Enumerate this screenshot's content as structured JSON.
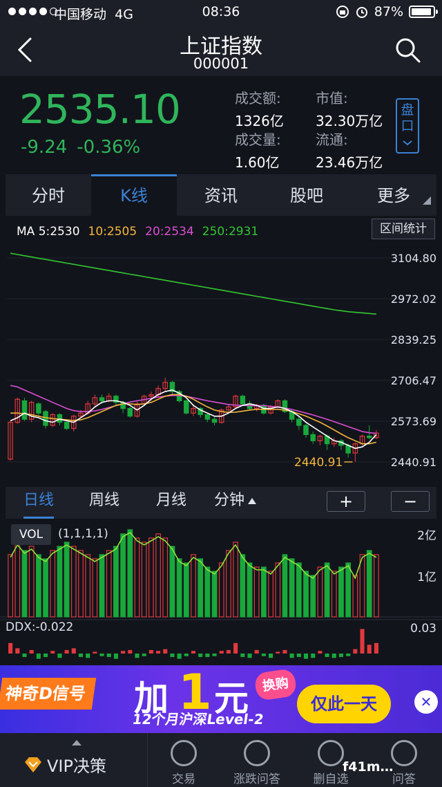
{
  "status": {
    "carrier": "中国移动",
    "network": "4G",
    "time": "08:36",
    "battery": "87%",
    "battery_level": 0.87
  },
  "nav": {
    "title": "上证指数",
    "code": "000001"
  },
  "quote": {
    "price": "2535.10",
    "change": "-9.24",
    "change_pct": "-0.36%",
    "turnover_label": "成交额:",
    "turnover": "1326亿",
    "mktcap_label": "市值:",
    "mktcap": "32.30万亿",
    "volume_label": "成交量:",
    "volume": "1.60亿",
    "float_label": "流通:",
    "float": "23.46万亿",
    "pan_label": "盘口"
  },
  "tabs": [
    "分时",
    "K线",
    "资讯",
    "股吧",
    "更多"
  ],
  "ma": {
    "ma5": "MA 5:2530",
    "ma10": "10:2505",
    "ma20": "20:2534",
    "ma250": "250:2931"
  },
  "range_button": "区间统计",
  "yaxis": [
    "3104.80",
    "2972.02",
    "2839.25",
    "2706.47",
    "2573.69",
    "2440.91"
  ],
  "low_marker": "2440.91",
  "periods": [
    "日线",
    "周线",
    "月线",
    "分钟"
  ],
  "zoom": {
    "plus": "+",
    "minus": "−"
  },
  "vol": {
    "tag": "VOL",
    "params": "(1,1,1,1)",
    "y_top": "2亿",
    "y_mid": "1亿"
  },
  "ddx": {
    "label": "DDX:-0.022",
    "y_top": "0.03"
  },
  "banner": {
    "tag": "神奇D信号",
    "jia": "加",
    "one": "1",
    "yuan": "元",
    "swap": "换购",
    "sub": "12个月沪深Level-2",
    "only": "仅此一天",
    "close": "✕"
  },
  "bottom": {
    "vip": "VIP决策",
    "items": [
      "交易",
      "涨跌问答",
      "删自选",
      "问答"
    ]
  },
  "watermark": "f41m…",
  "colors": {
    "up": "#e0393e",
    "down": "#18a83c",
    "accent": "#3b82d6",
    "ma5": "#ffffff",
    "ma10": "#f5b73b",
    "ma20": "#d94fd4",
    "ma250": "#32c832"
  },
  "chart_data": {
    "type": "candlestick",
    "ylim": [
      2440.91,
      3104.8
    ],
    "candles": [
      {
        "o": 2450,
        "c": 2570,
        "h": 2575,
        "l": 2445
      },
      {
        "o": 2570,
        "c": 2645,
        "h": 2650,
        "l": 2565
      },
      {
        "o": 2640,
        "c": 2580,
        "h": 2650,
        "l": 2575
      },
      {
        "o": 2580,
        "c": 2635,
        "h": 2640,
        "l": 2570
      },
      {
        "o": 2630,
        "c": 2600,
        "h": 2635,
        "l": 2590
      },
      {
        "o": 2605,
        "c": 2560,
        "h": 2610,
        "l": 2550
      },
      {
        "o": 2560,
        "c": 2595,
        "h": 2600,
        "l": 2555
      },
      {
        "o": 2595,
        "c": 2570,
        "h": 2600,
        "l": 2560
      },
      {
        "o": 2570,
        "c": 2550,
        "h": 2575,
        "l": 2545
      },
      {
        "o": 2550,
        "c": 2590,
        "h": 2595,
        "l": 2540
      },
      {
        "o": 2590,
        "c": 2600,
        "h": 2610,
        "l": 2585
      },
      {
        "o": 2600,
        "c": 2630,
        "h": 2640,
        "l": 2595
      },
      {
        "o": 2630,
        "c": 2650,
        "h": 2660,
        "l": 2620
      },
      {
        "o": 2650,
        "c": 2640,
        "h": 2660,
        "l": 2630
      },
      {
        "o": 2640,
        "c": 2655,
        "h": 2665,
        "l": 2635
      },
      {
        "o": 2655,
        "c": 2635,
        "h": 2660,
        "l": 2625
      },
      {
        "o": 2635,
        "c": 2615,
        "h": 2640,
        "l": 2600
      },
      {
        "o": 2615,
        "c": 2590,
        "h": 2620,
        "l": 2585
      },
      {
        "o": 2590,
        "c": 2630,
        "h": 2640,
        "l": 2585
      },
      {
        "o": 2630,
        "c": 2655,
        "h": 2660,
        "l": 2625
      },
      {
        "o": 2655,
        "c": 2660,
        "h": 2670,
        "l": 2640
      },
      {
        "o": 2660,
        "c": 2680,
        "h": 2690,
        "l": 2650
      },
      {
        "o": 2680,
        "c": 2700,
        "h": 2715,
        "l": 2670
      },
      {
        "o": 2700,
        "c": 2670,
        "h": 2705,
        "l": 2660
      },
      {
        "o": 2670,
        "c": 2640,
        "h": 2675,
        "l": 2635
      },
      {
        "o": 2640,
        "c": 2600,
        "h": 2645,
        "l": 2595
      },
      {
        "o": 2600,
        "c": 2615,
        "h": 2625,
        "l": 2590
      },
      {
        "o": 2615,
        "c": 2595,
        "h": 2620,
        "l": 2585
      },
      {
        "o": 2595,
        "c": 2580,
        "h": 2600,
        "l": 2570
      },
      {
        "o": 2580,
        "c": 2570,
        "h": 2590,
        "l": 2560
      },
      {
        "o": 2570,
        "c": 2610,
        "h": 2615,
        "l": 2565
      },
      {
        "o": 2610,
        "c": 2620,
        "h": 2630,
        "l": 2600
      },
      {
        "o": 2620,
        "c": 2655,
        "h": 2660,
        "l": 2615
      },
      {
        "o": 2655,
        "c": 2630,
        "h": 2660,
        "l": 2625
      },
      {
        "o": 2630,
        "c": 2615,
        "h": 2640,
        "l": 2610
      },
      {
        "o": 2615,
        "c": 2625,
        "h": 2630,
        "l": 2605
      },
      {
        "o": 2625,
        "c": 2600,
        "h": 2630,
        "l": 2595
      },
      {
        "o": 2600,
        "c": 2620,
        "h": 2625,
        "l": 2595
      },
      {
        "o": 2620,
        "c": 2640,
        "h": 2645,
        "l": 2615
      },
      {
        "o": 2640,
        "c": 2605,
        "h": 2645,
        "l": 2600
      },
      {
        "o": 2605,
        "c": 2580,
        "h": 2610,
        "l": 2570
      },
      {
        "o": 2580,
        "c": 2560,
        "h": 2590,
        "l": 2545
      },
      {
        "o": 2560,
        "c": 2530,
        "h": 2565,
        "l": 2520
      },
      {
        "o": 2530,
        "c": 2510,
        "h": 2540,
        "l": 2500
      },
      {
        "o": 2510,
        "c": 2525,
        "h": 2530,
        "l": 2495
      },
      {
        "o": 2525,
        "c": 2500,
        "h": 2530,
        "l": 2480
      },
      {
        "o": 2500,
        "c": 2510,
        "h": 2520,
        "l": 2490
      },
      {
        "o": 2510,
        "c": 2495,
        "h": 2515,
        "l": 2480
      },
      {
        "o": 2495,
        "c": 2470,
        "h": 2500,
        "l": 2455
      },
      {
        "o": 2470,
        "c": 2500,
        "h": 2505,
        "l": 2441
      },
      {
        "o": 2500,
        "c": 2525,
        "h": 2530,
        "l": 2495
      },
      {
        "o": 2525,
        "c": 2520,
        "h": 2560,
        "l": 2515
      },
      {
        "o": 2520,
        "c": 2535,
        "h": 2545,
        "l": 2515
      }
    ],
    "ma5": [
      2575,
      2585,
      2600,
      2590,
      2585,
      2575,
      2570,
      2580,
      2575,
      2570,
      2585,
      2600,
      2620,
      2635,
      2640,
      2640,
      2635,
      2625,
      2610,
      2625,
      2645,
      2660,
      2670,
      2675,
      2665,
      2650,
      2625,
      2610,
      2600,
      2590,
      2590,
      2600,
      2615,
      2625,
      2630,
      2625,
      2615,
      2615,
      2620,
      2615,
      2605,
      2590,
      2570,
      2555,
      2540,
      2525,
      2510,
      2505,
      2495,
      2485,
      2490,
      2505,
      2530
    ],
    "ma10": [
      2600,
      2600,
      2598,
      2595,
      2590,
      2585,
      2582,
      2580,
      2578,
      2576,
      2578,
      2585,
      2595,
      2605,
      2615,
      2625,
      2630,
      2630,
      2628,
      2630,
      2635,
      2645,
      2655,
      2660,
      2660,
      2655,
      2645,
      2632,
      2620,
      2610,
      2605,
      2602,
      2603,
      2606,
      2610,
      2612,
      2612,
      2612,
      2612,
      2610,
      2605,
      2598,
      2590,
      2580,
      2570,
      2558,
      2545,
      2532,
      2520,
      2510,
      2500,
      2500,
      2505
    ],
    "ma20": [
      2690,
      2685,
      2675,
      2665,
      2655,
      2645,
      2635,
      2625,
      2615,
      2608,
      2605,
      2605,
      2607,
      2612,
      2618,
      2624,
      2630,
      2636,
      2640,
      2644,
      2648,
      2652,
      2655,
      2657,
      2657,
      2655,
      2650,
      2645,
      2640,
      2636,
      2632,
      2628,
      2626,
      2625,
      2624,
      2624,
      2624,
      2622,
      2620,
      2616,
      2612,
      2606,
      2600,
      2594,
      2587,
      2580,
      2572,
      2564,
      2556,
      2548,
      2540,
      2536,
      2534
    ],
    "ma250": [
      3120,
      3116,
      3112,
      3108,
      3104,
      3100,
      3096,
      3092,
      3088,
      3084,
      3080,
      3076,
      3072,
      3068,
      3064,
      3060,
      3056,
      3052,
      3048,
      3044,
      3040,
      3036,
      3032,
      3028,
      3024,
      3020,
      3016,
      3012,
      3008,
      3004,
      3000,
      2996,
      2992,
      2988,
      2984,
      2980,
      2976,
      2972,
      2968,
      2964,
      2960,
      2956,
      2952,
      2948,
      2944,
      2940,
      2936,
      2933,
      2930,
      2928,
      2926,
      2924,
      2922
    ],
    "volume_ylim": [
      0,
      2.2
    ],
    "volume": [
      1.5,
      1.8,
      1.6,
      1.7,
      1.5,
      1.4,
      1.6,
      1.7,
      1.8,
      1.7,
      1.6,
      1.5,
      1.4,
      1.5,
      1.6,
      1.7,
      2.0,
      2.1,
      1.9,
      1.8,
      1.9,
      2.0,
      1.9,
      1.7,
      1.4,
      1.3,
      1.5,
      1.4,
      1.2,
      1.1,
      1.3,
      1.6,
      1.8,
      1.5,
      1.3,
      1.2,
      1.2,
      1.1,
      1.3,
      1.5,
      1.4,
      1.3,
      1.1,
      1.0,
      1.2,
      1.3,
      1.1,
      1.2,
      1.3,
      1.0,
      1.5,
      1.6,
      1.5
    ],
    "ddx_ylim": [
      -0.03,
      0.03
    ],
    "ddx": [
      0.012,
      0.006,
      -0.004,
      0.004,
      -0.006,
      -0.004,
      0.003,
      -0.005,
      0.004,
      0.006,
      -0.004,
      -0.005,
      0.002,
      -0.003,
      -0.004,
      -0.006,
      0.003,
      0.004,
      -0.005,
      -0.003,
      0.004,
      0.003,
      0.005,
      -0.004,
      -0.006,
      -0.003,
      0.003,
      -0.004,
      -0.004,
      -0.003,
      0.003,
      0.004,
      0.012,
      -0.004,
      -0.005,
      0.004,
      -0.003,
      -0.005,
      0.002,
      0.004,
      -0.005,
      -0.004,
      -0.006,
      -0.005,
      0.003,
      -0.004,
      -0.005,
      -0.004,
      -0.003,
      0.005,
      0.028,
      0.01,
      0.012
    ]
  }
}
